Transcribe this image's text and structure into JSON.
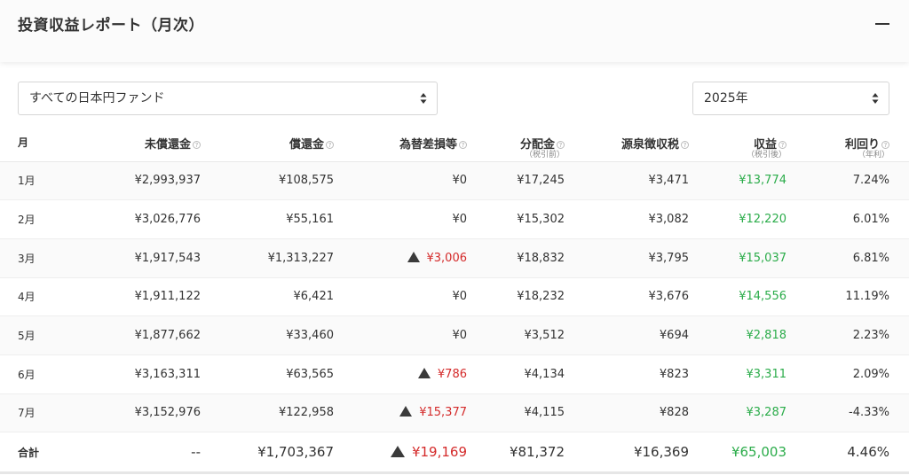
{
  "header": {
    "title": "投資収益レポート（月次）"
  },
  "filters": {
    "fund_select": "すべての日本円ファンド",
    "year_select": "2025年"
  },
  "table": {
    "columns": [
      {
        "label": "月",
        "sub": "",
        "help": false
      },
      {
        "label": "未償還金",
        "sub": "",
        "help": true
      },
      {
        "label": "償還金",
        "sub": "",
        "help": true
      },
      {
        "label": "為替差損等",
        "sub": "",
        "help": true
      },
      {
        "label": "分配金",
        "sub": "（税引前）",
        "help": true
      },
      {
        "label": "源泉徴収税",
        "sub": "",
        "help": true
      },
      {
        "label": "収益",
        "sub": "（税引後）",
        "help": true
      },
      {
        "label": "利回り",
        "sub": "（年利）",
        "help": true
      }
    ],
    "rows": [
      {
        "month": "1月",
        "unredeemed": "¥2,993,937",
        "redeemed": "¥108,575",
        "fx": "¥0",
        "fx_loss": false,
        "dist": "¥17,245",
        "tax": "¥3,471",
        "profit": "¥13,774",
        "yield": "7.24%"
      },
      {
        "month": "2月",
        "unredeemed": "¥3,026,776",
        "redeemed": "¥55,161",
        "fx": "¥0",
        "fx_loss": false,
        "dist": "¥15,302",
        "tax": "¥3,082",
        "profit": "¥12,220",
        "yield": "6.01%"
      },
      {
        "month": "3月",
        "unredeemed": "¥1,917,543",
        "redeemed": "¥1,313,227",
        "fx": "¥3,006",
        "fx_loss": true,
        "dist": "¥18,832",
        "tax": "¥3,795",
        "profit": "¥15,037",
        "yield": "6.81%"
      },
      {
        "month": "4月",
        "unredeemed": "¥1,911,122",
        "redeemed": "¥6,421",
        "fx": "¥0",
        "fx_loss": false,
        "dist": "¥18,232",
        "tax": "¥3,676",
        "profit": "¥14,556",
        "yield": "11.19%"
      },
      {
        "month": "5月",
        "unredeemed": "¥1,877,662",
        "redeemed": "¥33,460",
        "fx": "¥0",
        "fx_loss": false,
        "dist": "¥3,512",
        "tax": "¥694",
        "profit": "¥2,818",
        "yield": "2.23%"
      },
      {
        "month": "6月",
        "unredeemed": "¥3,163,311",
        "redeemed": "¥63,565",
        "fx": "¥786",
        "fx_loss": true,
        "dist": "¥4,134",
        "tax": "¥823",
        "profit": "¥3,311",
        "yield": "2.09%"
      },
      {
        "month": "7月",
        "unredeemed": "¥3,152,976",
        "redeemed": "¥122,958",
        "fx": "¥15,377",
        "fx_loss": true,
        "dist": "¥4,115",
        "tax": "¥828",
        "profit": "¥3,287",
        "yield": "-4.33%"
      }
    ],
    "total": {
      "month": "合計",
      "unredeemed": "--",
      "redeemed": "¥1,703,367",
      "fx": "¥19,169",
      "fx_loss": true,
      "dist": "¥81,372",
      "tax": "¥16,369",
      "profit": "¥65,003",
      "yield": "4.46%"
    }
  },
  "colors": {
    "profit": "#2bac4a",
    "loss": "#d42a2a"
  },
  "icons": {
    "collapse": "minus-icon",
    "select_arrows": "updown-arrows-icon",
    "help": "question-circle-icon",
    "loss_marker": "triangle-up-icon"
  }
}
